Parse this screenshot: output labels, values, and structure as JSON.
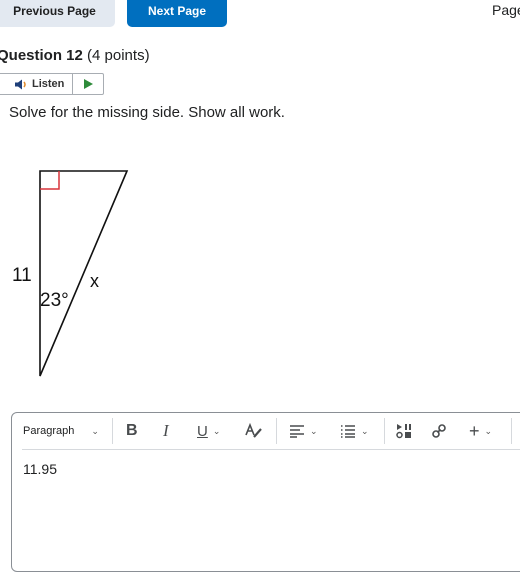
{
  "nav": {
    "previous_label": "Previous Page",
    "next_label": "Next Page",
    "page_label": "Page"
  },
  "question": {
    "title": "Question 12",
    "points": "(4 points)",
    "prompt": "Solve for the missing side. Show all work."
  },
  "listen": {
    "label": "Listen",
    "speaker_icon": "speaker-icon",
    "play_icon": "play-icon"
  },
  "figure": {
    "side_label": "11",
    "angle_label": "23°",
    "unknown_label": "x",
    "right_angle_color": "#d9343a"
  },
  "editor": {
    "block_format": "Paragraph",
    "toolbar": [
      "bold",
      "italic",
      "underline",
      "format-text",
      "align",
      "list",
      "insert-stuff",
      "link",
      "insert-more"
    ],
    "content": "11.95"
  },
  "colors": {
    "primary": "#006fbf",
    "secondary_button": "#e3e9f1",
    "play_green": "#2e8b3a"
  }
}
